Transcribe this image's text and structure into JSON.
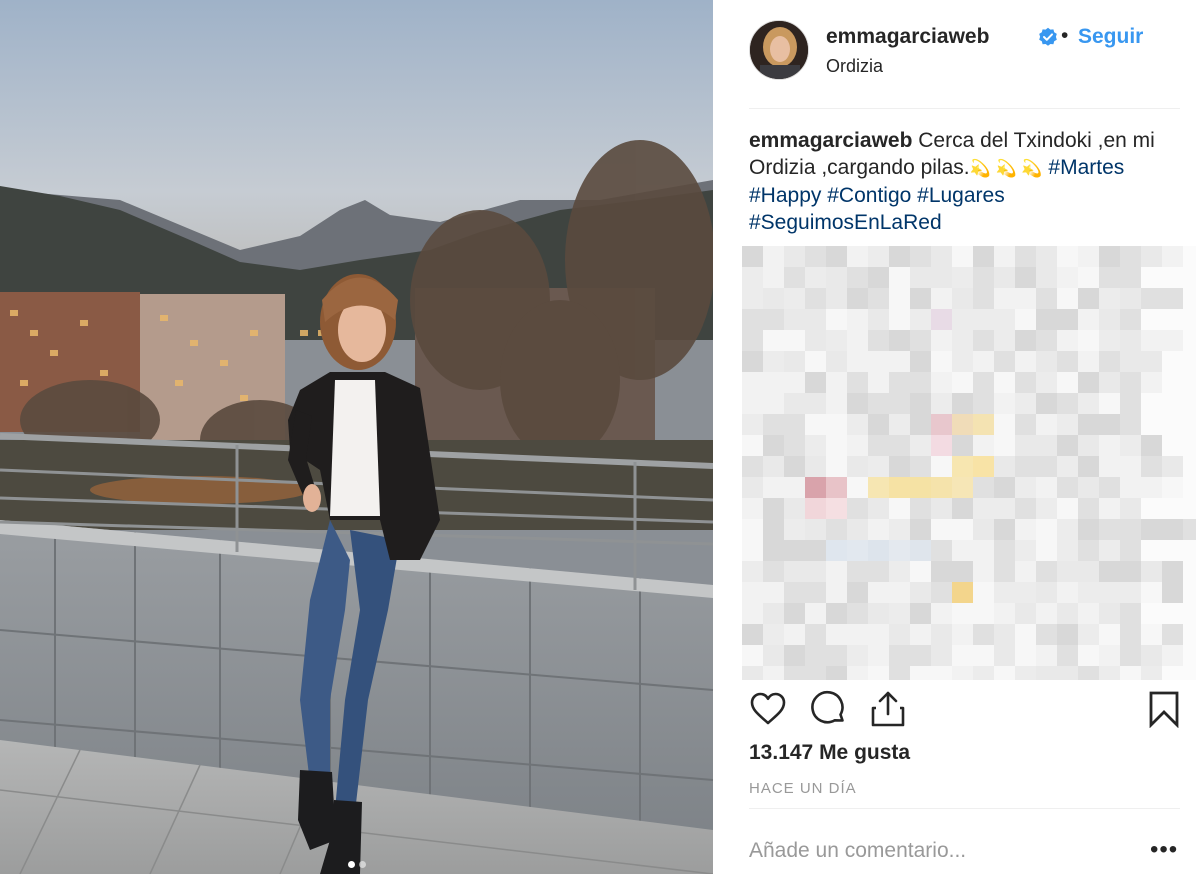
{
  "post": {
    "username": "emmagarciaweb",
    "separator": "•",
    "follow_label": "Seguir",
    "location": "Ordizia",
    "caption": {
      "username": "emmagarciaweb",
      "text_1": "Cerca del Txindoki ,en mi Ordizia ,cargando pilas.",
      "emojis": "💫 💫 💫",
      "tags": [
        "#Martes",
        "#Happy",
        "#Contigo",
        "#Lugares",
        "#SeguimosEnLaRed"
      ]
    },
    "likes": "13.147 Me gusta",
    "timestamp": "HACE UN DÍA",
    "comment_placeholder": "Añade un comentario...",
    "more_label": "•••",
    "carousel": {
      "count": 2,
      "active_index": 0
    }
  },
  "icons": {
    "verified": "verified-badge-icon",
    "like": "heart-icon",
    "comment": "comment-bubble-icon",
    "share": "share-icon",
    "save": "bookmark-icon"
  },
  "colors": {
    "link": "#3897f0",
    "hashtag": "#003569",
    "text": "#262626",
    "muted": "#999999",
    "divider": "#efefef"
  }
}
